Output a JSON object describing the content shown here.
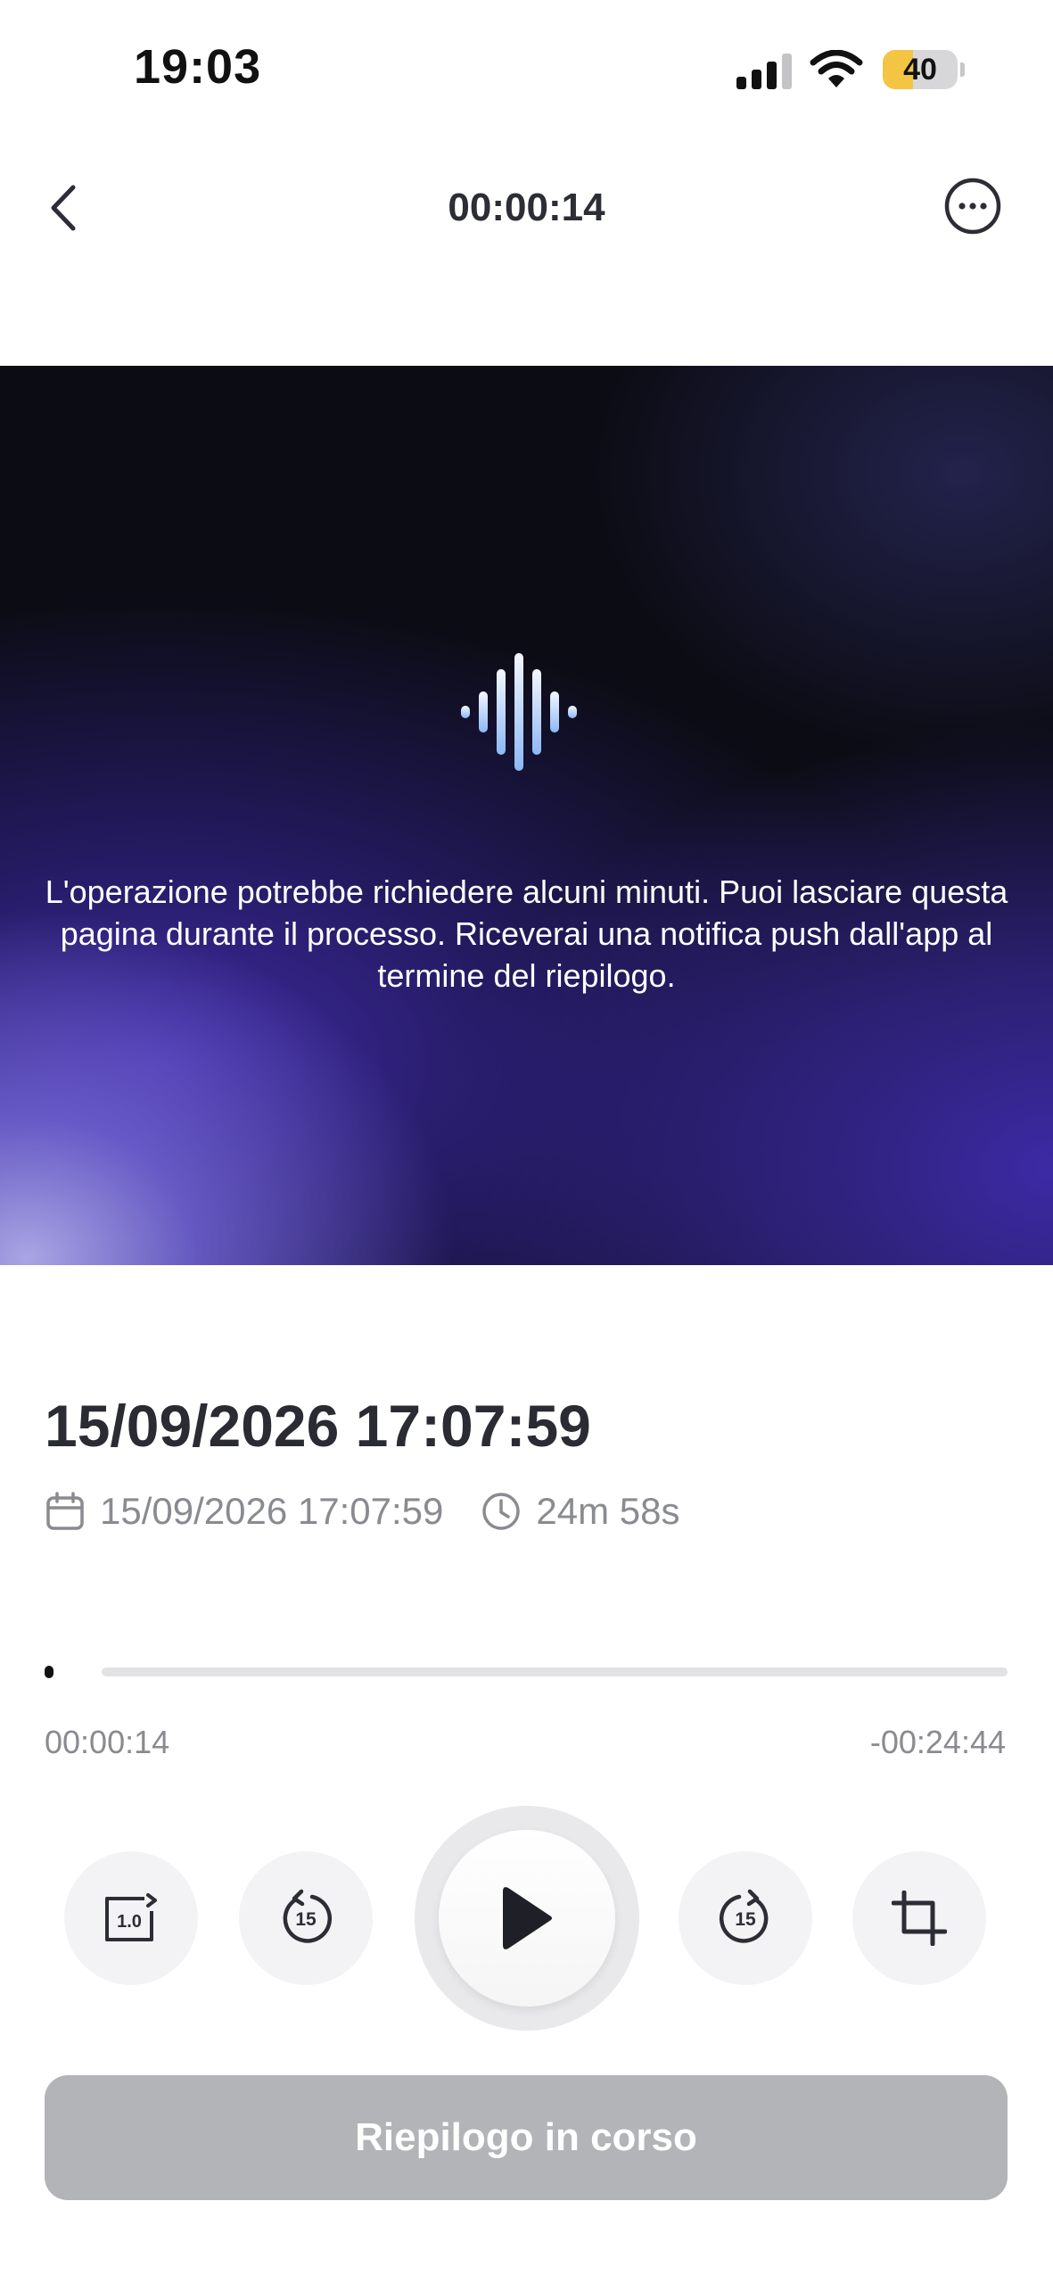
{
  "status_bar": {
    "time": "19:03",
    "battery": "40",
    "battery_level": 0.4
  },
  "header": {
    "title": "00:00:14"
  },
  "hero": {
    "message": "L'operazione potrebbe richiedere alcuni minuti. Puoi lasciare questa pagina durante il processo. Riceverai una notifica push dall'app al termine del riepilogo."
  },
  "recording": {
    "title": "15/09/2026 17:07:59",
    "date": "15/09/2026 17:07:59",
    "duration": "24m 58s"
  },
  "player": {
    "elapsed": "00:00:14",
    "remaining": "-00:24:44",
    "progress": 0.009,
    "speed_label": "1.0",
    "skip_seconds": "15"
  },
  "actions": {
    "summary_label": "Riepilogo in corso"
  },
  "icons": {
    "back": "chevron-left-icon",
    "more": "ellipsis-circle-icon",
    "wave": "sound-wave-icon",
    "calendar": "calendar-icon",
    "clock": "clock-icon",
    "speed": "playback-speed-icon",
    "rewind": "rewind-15-icon",
    "play": "play-icon",
    "forward": "forward-15-icon",
    "crop": "crop-icon"
  },
  "colors": {
    "accent_purple": "#3a2a9e",
    "button_disabled": "#b3b4b7",
    "battery_yellow": "#f4c542"
  }
}
